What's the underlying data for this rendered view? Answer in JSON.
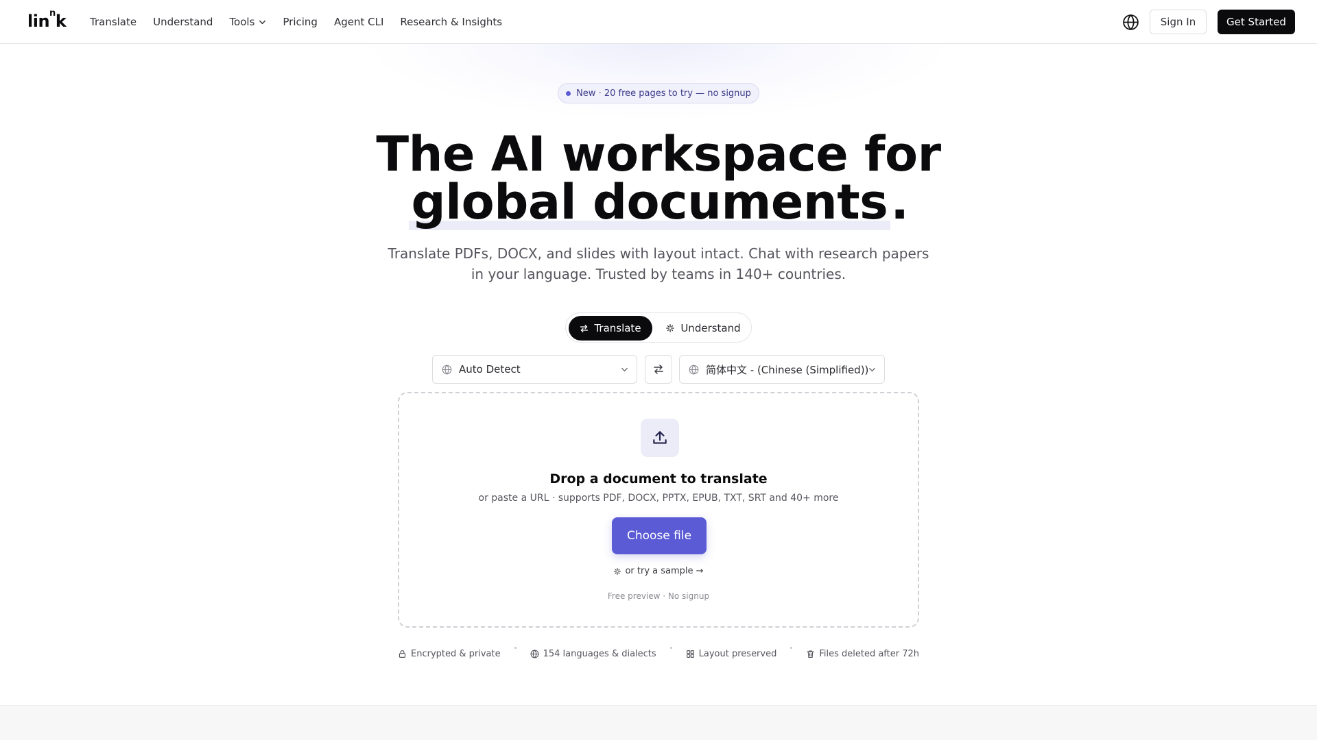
{
  "nav": {
    "logo_text": "lin",
    "logo_sup": "n",
    "logo_end": "k",
    "links": [
      {
        "label": "Translate"
      },
      {
        "label": "Understand"
      },
      {
        "label": "Tools",
        "has_dropdown": true
      },
      {
        "label": "Pricing"
      },
      {
        "label": "Agent CLI"
      },
      {
        "label": "Research & Insights"
      }
    ],
    "language_icon": "globe-icon",
    "signin_label": "Sign In",
    "get_started_label": "Get Started"
  },
  "hero": {
    "badge": "New · 20 free pages to try — no signup",
    "headline_line1": "The AI workspace for",
    "headline_highlight": "global documents",
    "headline_end": ".",
    "subtitle": "Translate PDFs, DOCX, and slides with layout intact. Chat with research papers in your language. Trusted by teams in 140+ countries."
  },
  "mode_toggle": {
    "translate_label": "Translate",
    "understand_label": "Understand",
    "active": "Translate"
  },
  "languages": {
    "source": "Auto Detect",
    "target": "简体中文 - (Chinese (Simplified))"
  },
  "dropzone": {
    "title": "Drop a document to translate",
    "subtitle": "or paste a URL · supports PDF, DOCX, PPTX, EPUB, TXT, SRT and 40+ more",
    "choose_label": "Choose file",
    "sample_label": "or try a sample →",
    "footnote": "Free preview · No signup"
  },
  "features": [
    {
      "icon": "lock-icon",
      "label": "Encrypted & private"
    },
    {
      "icon": "globe-icon",
      "label": "154 languages & dialects"
    },
    {
      "icon": "grid-icon",
      "label": "Layout preserved"
    },
    {
      "icon": "trash-icon",
      "label": "Files deleted after 72h"
    }
  ],
  "colors": {
    "accent": "#5b5bd6",
    "dark": "#0b0b0d",
    "badge_bg": "#f1f1fb"
  }
}
